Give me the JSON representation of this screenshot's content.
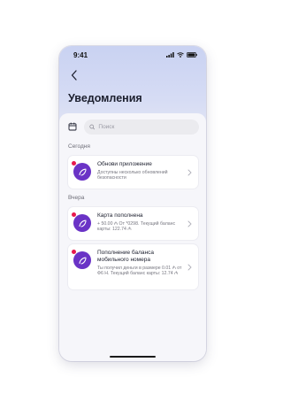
{
  "status_bar": {
    "time": "9:41",
    "icons": [
      "signal-icon",
      "wifi-icon",
      "battery-icon"
    ]
  },
  "header": {
    "back_icon": "chevron-left-icon",
    "title": "Уведомления"
  },
  "search": {
    "filter_icon": "calendar-filter-icon",
    "placeholder": "Поиск",
    "value": ""
  },
  "sections": {
    "today": {
      "label": "Сегодня",
      "items": [
        {
          "title": "Обнови приложение",
          "text": "Доступны несколько обновлений безопасности",
          "unread": true
        }
      ]
    },
    "yesterday": {
      "label": "Вчера",
      "items": [
        {
          "title": "Карта пополнена",
          "text": "+ 50.00 ₼ От *0298. Текущий баланс карты: 122.74 ₼",
          "unread": true
        },
        {
          "title": "Пополнение баланса мобильного номера",
          "text": "Ты получил деньги в размере 0.01 ₼ от Ф6 Н. Текущий баланс карты: 12.74 ₼",
          "unread": true
        }
      ]
    }
  },
  "colors": {
    "accent": "#6a33c6",
    "unread_dot": "#e8194d",
    "header_gradient_top": "#c9d2f2"
  }
}
